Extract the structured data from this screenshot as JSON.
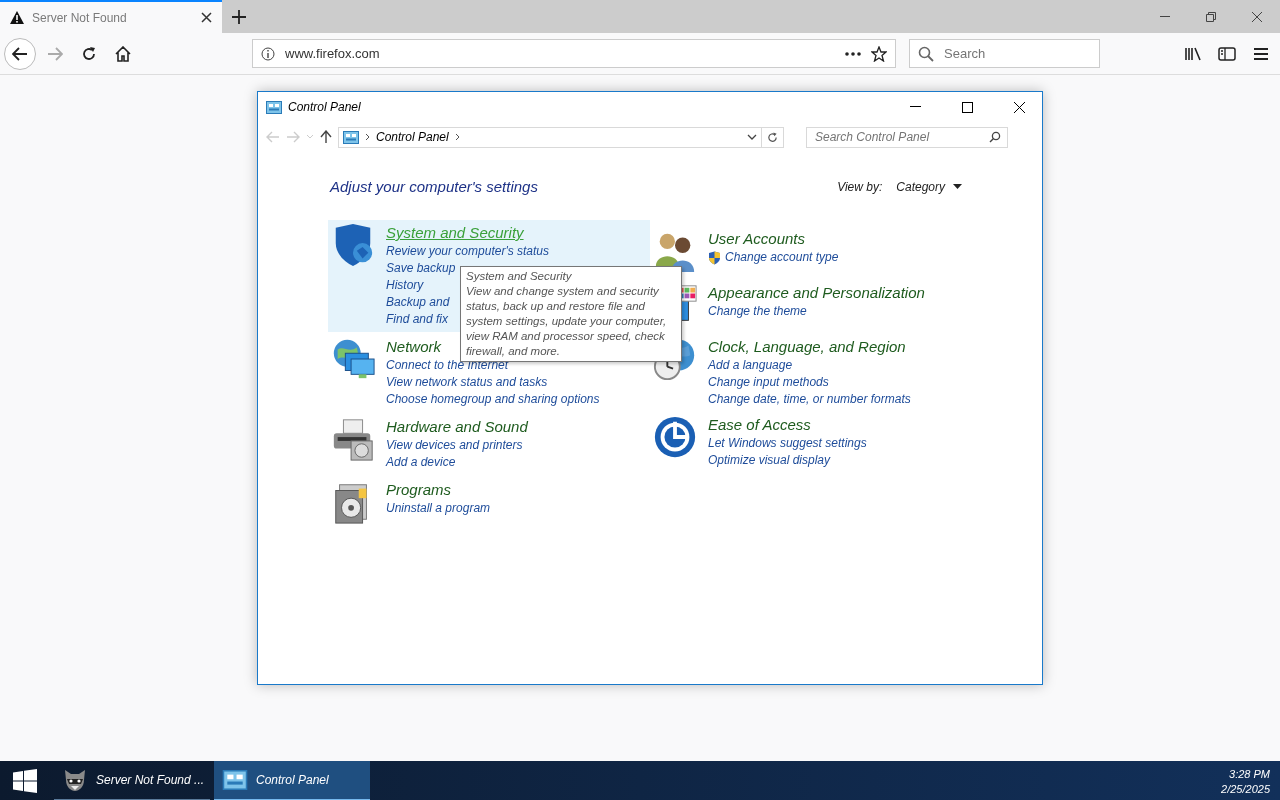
{
  "browser": {
    "tabs": [
      {
        "title": "Server Not Found",
        "selected": true
      }
    ],
    "address": "www.firefox.com",
    "search": {
      "placeholder": "Search"
    }
  },
  "window": {
    "title": "Control Panel",
    "breadcrumb": [
      "Control Panel"
    ],
    "search": {
      "placeholder": "Search Control Panel"
    },
    "heading": "Adjust your computer's settings",
    "view_by": {
      "label": "View by:",
      "value": "Category"
    },
    "left_categories": [
      {
        "title": "System and Security",
        "hovered": true,
        "links": [
          {
            "text": "Review your computer's status",
            "kind": "plain"
          },
          {
            "text": "Save backup",
            "kind": "plain"
          },
          {
            "text": "History",
            "kind": "plain"
          },
          {
            "text": "Backup and",
            "kind": "plain"
          },
          {
            "text": "Find and fix",
            "kind": "plain"
          }
        ]
      },
      {
        "title": "Network",
        "hovered": false,
        "links": [
          {
            "text": "Connect to the Internet",
            "kind": "plain"
          },
          {
            "text": "View network status and tasks",
            "kind": "plain"
          },
          {
            "text": "Choose homegroup and sharing options",
            "kind": "plain"
          }
        ]
      },
      {
        "title": "Hardware and Sound",
        "hovered": false,
        "links": [
          {
            "text": "View devices and printers",
            "kind": "plain"
          },
          {
            "text": "Add a device",
            "kind": "plain"
          }
        ]
      },
      {
        "title": "Programs",
        "hovered": false,
        "links": [
          {
            "text": "Uninstall a program",
            "kind": "plain"
          }
        ]
      }
    ],
    "right_categories": [
      {
        "title": "User Accounts",
        "hovered": false,
        "links": [
          {
            "text": "Change account type",
            "kind": "admin"
          }
        ]
      },
      {
        "title": "Appearance and Personalization",
        "hovered": false,
        "links": [
          {
            "text": "Change the theme",
            "kind": "plain"
          }
        ]
      },
      {
        "title": "Clock, Language, and Region",
        "hovered": false,
        "links": [
          {
            "text": "Add a language",
            "kind": "plain"
          },
          {
            "text": "Change input methods",
            "kind": "plain"
          },
          {
            "text": "Change date, time, or number formats",
            "kind": "plain"
          }
        ]
      },
      {
        "title": "Ease of Access",
        "hovered": false,
        "links": [
          {
            "text": "Let Windows suggest settings",
            "kind": "plain"
          },
          {
            "text": "Optimize visual display",
            "kind": "plain"
          }
        ]
      }
    ],
    "tooltip": {
      "title": "System and Security",
      "text": "View and change system and security status, back up and restore file and system settings, update your computer, view RAM and processor speed, check firewall, and more."
    }
  },
  "taskbar": {
    "items": [
      {
        "label": "Server Not Found ...",
        "selected": false
      },
      {
        "label": "Control Panel",
        "selected": true
      }
    ],
    "time": "3:28 PM",
    "date": "2/25/2025"
  }
}
